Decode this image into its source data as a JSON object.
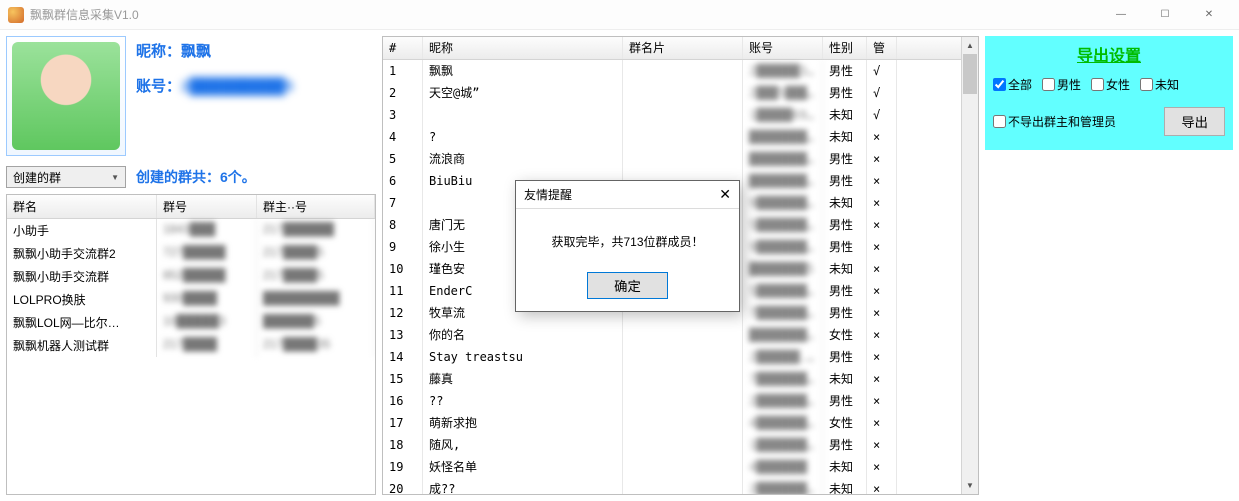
{
  "window": {
    "title": "飘飘群信息采集V1.0"
  },
  "profile": {
    "nick_label": "昵称：",
    "nick_value": "飘飘",
    "acct_label": "账号：",
    "acct_value": "2█████████5"
  },
  "group_selector": {
    "label": "创建的群",
    "count_text": "创建的群共：6个。"
  },
  "group_table": {
    "headers": {
      "name": "群名",
      "id": "群号",
      "owner": "群主··号"
    },
    "rows": [
      {
        "name": "小助手",
        "id": "1843███",
        "owner": "217██████"
      },
      {
        "name": "飘飘小助手交流群2",
        "id": "727█████",
        "owner": "217████5"
      },
      {
        "name": "飘飘小助手交流群",
        "id": "852█████",
        "owner": "217████5"
      },
      {
        "name": "LOLPRO换肤",
        "id": "930████",
        "owner": "█████████"
      },
      {
        "name": "飘飘LOL网—比尔…",
        "id": "10█████3",
        "owner": "██████5"
      },
      {
        "name": "飘飘机器人测试群",
        "id": "217████",
        "owner": "217████35"
      }
    ]
  },
  "member_table": {
    "headers": {
      "idx": "#",
      "nick": "昵称",
      "card": "群名片",
      "acct": "账号",
      "sex": "性别",
      "admin": "管"
    },
    "rows": [
      {
        "idx": "1",
        "nick": "飘飘",
        "card": "",
        "acct": "2██████355",
        "sex": "男性",
        "admin": "√"
      },
      {
        "idx": "2",
        "nick": "天空@城”",
        "card": "",
        "acct": "2███5███32",
        "sex": "男性",
        "admin": "√"
      },
      {
        "idx": "3",
        "nick": "",
        "card": "",
        "acct": "1█████6983",
        "sex": "未知",
        "admin": "√"
      },
      {
        "idx": "4",
        "nick": "?&nbsp",
        "card": "",
        "acct": "████████158",
        "sex": "未知",
        "admin": "×"
      },
      {
        "idx": "5",
        "nick": "流浪商",
        "card": "",
        "acct": "████████.549",
        "sex": "男性",
        "admin": "×"
      },
      {
        "idx": "6",
        "nick": "BiuBiu",
        "card": "",
        "acct": "████████4539",
        "sex": "男性",
        "admin": "×"
      },
      {
        "idx": "7",
        "nick": "",
        "card": "",
        "acct": "9███████130",
        "sex": "未知",
        "admin": "×"
      },
      {
        "idx": "8",
        "nick": "唐门无",
        "card": "",
        "acct": "5███████886",
        "sex": "男性",
        "admin": "×"
      },
      {
        "idx": "9",
        "nick": "徐小生",
        "card": "",
        "acct": "9███████369",
        "sex": "男性",
        "admin": "×"
      },
      {
        "idx": "10",
        "nick": "瑾色安",
        "card": "",
        "acct": "████████5",
        "sex": "未知",
        "admin": "×"
      },
      {
        "idx": "11",
        "nick": "EnderC",
        "card": "",
        "acct": "5███████923",
        "sex": "男性",
        "admin": "×"
      },
      {
        "idx": "12",
        "nick": "牧草流",
        "card": "",
        "acct": "7███████1.3",
        "sex": "男性",
        "admin": "×"
      },
      {
        "idx": "13",
        "nick": "你的名",
        "card": "",
        "acct": "████████7884",
        "sex": "女性",
        "admin": "×"
      },
      {
        "idx": "14",
        "nick": "Stay&nbsp;treastsu",
        "card": "",
        "acct": "2██████.169",
        "sex": "男性",
        "admin": "×"
      },
      {
        "idx": "15",
        "nick": "藤真",
        "card": "",
        "acct": "7███████646",
        "sex": "未知",
        "admin": "×"
      },
      {
        "idx": "16",
        "nick": "??",
        "card": "",
        "acct": "2███████72",
        "sex": "男性",
        "admin": "×"
      },
      {
        "idx": "17",
        "nick": "萌新求抱",
        "card": "",
        "acct": "4███████372",
        "sex": "女性",
        "admin": "×"
      },
      {
        "idx": "18",
        "nick": "随风,",
        "card": "",
        "acct": "1███████5688",
        "sex": "男性",
        "admin": "×"
      },
      {
        "idx": "19",
        "nick": "妖怪名单",
        "card": "",
        "acct": "4███████",
        "sex": "未知",
        "admin": "×"
      },
      {
        "idx": "20",
        "nick": "成??",
        "card": "",
        "acct": "2███████.575",
        "sex": "未知",
        "admin": "×"
      }
    ]
  },
  "export": {
    "title": "导出设置",
    "chk_all": "全部",
    "chk_male": "男性",
    "chk_female": "女性",
    "chk_unknown": "未知",
    "chk_exclude": "不导出群主和管理员",
    "btn": "导出"
  },
  "dialog": {
    "title": "友情提醒",
    "message": "获取完毕，共713位群成员！",
    "ok": "确定"
  }
}
